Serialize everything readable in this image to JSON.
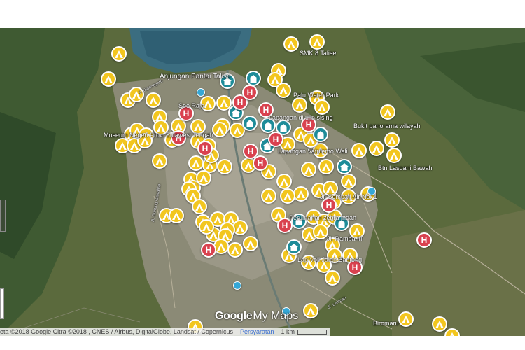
{
  "map": {
    "brand": {
      "google": "Google",
      "mymaps": "My Maps"
    },
    "attribution": {
      "credit": "eta ©2018 Google Citra ©2018 , CNES / Airbus, DigitalGlobe, Landsat / Copernicus",
      "terms": "Persyaratan",
      "scale": "1 km"
    },
    "place_labels": [
      "SMK 8 Talise",
      "Anjungan Pantai Talise",
      "Soe Raja",
      "Palu Water Park",
      "Lapangan di ujin sising",
      "Bukit panorama wilayah",
      "Museum Negeri Prov. Sulawesi Tengah",
      "Lapangan Vatulemo Wali",
      "Btn Lasoani Bawah",
      "Jl. Sempati Air No. 1",
      "Perumahan zebra indah",
      "Jl. Ramba III",
      "Lap Voli Jalan Banteng",
      "Biromaru"
    ],
    "road_labels": [
      "Jl. Diponegoro",
      "Jl. Gunung Gawalise",
      "Jl. Lembah"
    ],
    "marker_types": {
      "camp": {
        "icon": "tent-icon",
        "color": "#f2c61f"
      },
      "hospital": {
        "icon": "hospital-icon",
        "letter": "H",
        "color": "#d9424f"
      },
      "shelter": {
        "icon": "house-icon",
        "color": "#1e8c99"
      },
      "poi": {
        "icon": "place-icon",
        "color": "#35a7d6"
      }
    }
  }
}
